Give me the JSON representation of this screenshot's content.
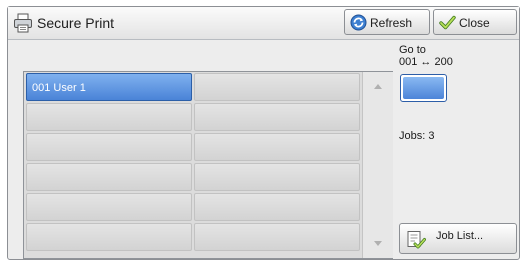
{
  "window": {
    "title": "Secure Print",
    "title_icon": "printer-icon"
  },
  "header": {
    "refresh_label": "Refresh",
    "refresh_icon": "refresh-icon",
    "close_label": "Close",
    "close_icon": "checkmark-icon"
  },
  "user_list": {
    "rows": [
      [
        "001  User 1",
        ""
      ],
      [
        "",
        ""
      ],
      [
        "",
        ""
      ],
      [
        "",
        ""
      ],
      [
        "",
        ""
      ],
      [
        "",
        ""
      ]
    ],
    "selected": "001  User 1"
  },
  "goto": {
    "label": "Go to",
    "range": "001 ↔ 200"
  },
  "jobs": {
    "label": "Jobs: 3"
  },
  "job_list_button": {
    "label": "Job List...",
    "icon": "job-list-icon"
  },
  "colors": {
    "selected": "#4a83d7",
    "panel": "#ededed"
  }
}
